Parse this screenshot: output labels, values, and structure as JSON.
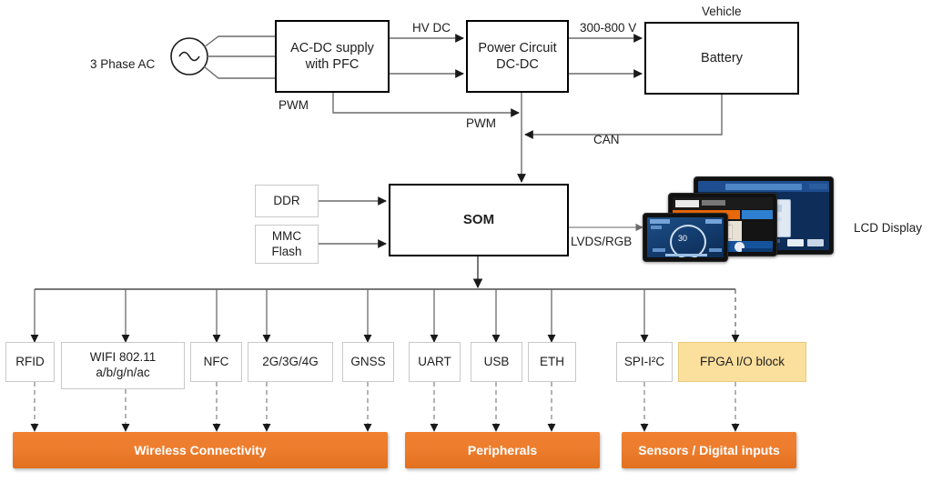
{
  "diagram": {
    "title": "EV charger SOM block diagram",
    "power_chain": {
      "source_label": "3 Phase AC",
      "ac_dc": "AC-DC supply\nwith PFC",
      "ac_dc_line1": "AC-DC supply",
      "ac_dc_line2": "with PFC",
      "power_circuit_line1": "Power Circuit",
      "power_circuit_line2": "DC-DC",
      "battery": "Battery",
      "vehicle": "Vehicle"
    },
    "signals": {
      "hv_dc": "HV DC",
      "voltage_range": "300-800 V",
      "pwm_1": "PWM",
      "pwm_2": "PWM",
      "can": "CAN",
      "lvds_rgb": "LVDS/RGB"
    },
    "memory": {
      "ddr": "DDR",
      "mmc_line1": "MMC",
      "mmc_line2": "Flash"
    },
    "som": {
      "label": "SOM"
    },
    "display": {
      "label": "LCD  Display"
    },
    "peripherals": [
      {
        "id": "rfid",
        "label": "RFID",
        "line2": "",
        "highlight": false
      },
      {
        "id": "wifi",
        "label": "WIFI 802.11",
        "line2": "a/b/g/n/ac",
        "highlight": false
      },
      {
        "id": "nfc",
        "label": "NFC",
        "line2": "",
        "highlight": false
      },
      {
        "id": "cell",
        "label": "2G/3G/4G",
        "line2": "",
        "highlight": false
      },
      {
        "id": "gnss",
        "label": "GNSS",
        "line2": "",
        "highlight": false
      },
      {
        "id": "uart",
        "label": "UART",
        "line2": "",
        "highlight": false
      },
      {
        "id": "usb",
        "label": "USB",
        "line2": "",
        "highlight": false
      },
      {
        "id": "eth",
        "label": "ETH",
        "line2": "",
        "highlight": false
      },
      {
        "id": "spi",
        "label": "SPI-I²C",
        "line2": "",
        "highlight": false
      },
      {
        "id": "fpga",
        "label": "FPGA I/O block",
        "line2": "",
        "highlight": true
      }
    ],
    "groups": [
      {
        "id": "wireless",
        "label": "Wireless Connectivity"
      },
      {
        "id": "peripherals",
        "label": "Peripherals"
      },
      {
        "id": "sensors",
        "label": "Sensors / Digital inputs"
      }
    ],
    "colors": {
      "orange": "#ed7d2e",
      "fpga_fill": "#fbdf9d",
      "line": "#6b6b6b",
      "box_border": "#c9c9c9",
      "heavy_border": "#000000"
    }
  }
}
